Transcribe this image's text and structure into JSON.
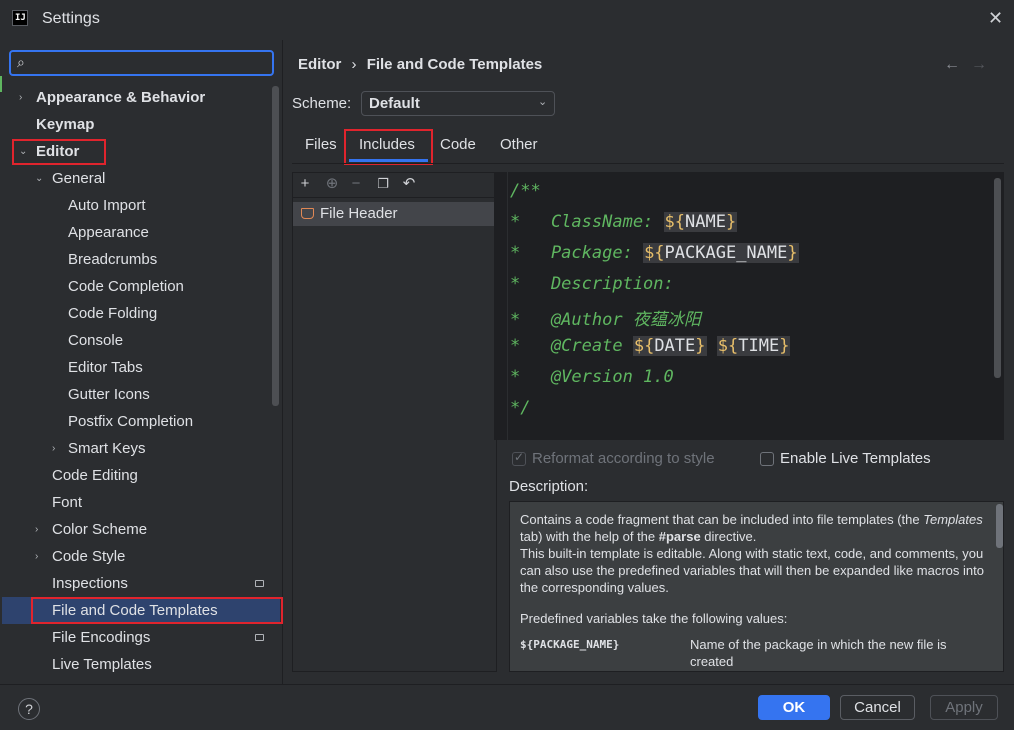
{
  "window": {
    "title": "Settings",
    "app_icon_text": "IJ"
  },
  "search": {
    "placeholder": ""
  },
  "sidebar": {
    "items": [
      {
        "label": "Appearance & Behavior"
      },
      {
        "label": "Keymap"
      },
      {
        "label": "Editor"
      },
      {
        "label": "General"
      },
      {
        "label": "Auto Import"
      },
      {
        "label": "Appearance"
      },
      {
        "label": "Breadcrumbs"
      },
      {
        "label": "Code Completion"
      },
      {
        "label": "Code Folding"
      },
      {
        "label": "Console"
      },
      {
        "label": "Editor Tabs"
      },
      {
        "label": "Gutter Icons"
      },
      {
        "label": "Postfix Completion"
      },
      {
        "label": "Smart Keys"
      },
      {
        "label": "Code Editing"
      },
      {
        "label": "Font"
      },
      {
        "label": "Color Scheme"
      },
      {
        "label": "Code Style"
      },
      {
        "label": "Inspections"
      },
      {
        "label": "File and Code Templates"
      },
      {
        "label": "File Encodings"
      },
      {
        "label": "Live Templates"
      }
    ],
    "selected": "File and Code Templates"
  },
  "header": {
    "breadcrumb_parent": "Editor",
    "breadcrumb_sep": "›",
    "breadcrumb_current": "File and Code Templates",
    "back_icon": "←",
    "forward_icon": "→"
  },
  "scheme": {
    "label": "Scheme:",
    "value": "Default"
  },
  "tabs": [
    {
      "label": "Files"
    },
    {
      "label": "Includes",
      "active": true
    },
    {
      "label": "Code"
    },
    {
      "label": "Other"
    }
  ],
  "templates_list": {
    "items": [
      {
        "label": "File Header"
      }
    ]
  },
  "editor": {
    "lines": {
      "l1": "/**",
      "l2_prefix": "*   ClassName: ",
      "l2_var": "${NAME}",
      "l3_prefix": "*   Package: ",
      "l3_var": "${PACKAGE_NAME}",
      "l4": "*   Description:",
      "l5": "*   @Author 夜蕴冰阳",
      "l6_prefix": "*   @Create ",
      "l6_var1": "${DATE}",
      "l6_var2": "${TIME}",
      "l7": "*   @Version 1.0",
      "l8": "*/"
    }
  },
  "options": {
    "reformat_label": "Reformat according to style",
    "reformat_checked": true,
    "reformat_disabled": true,
    "live_templates_label": "Enable Live Templates",
    "live_templates_checked": false
  },
  "description": {
    "label": "Description:",
    "p1_a": "Contains a code fragment that can be included into file templates (the ",
    "p1_templates": "Templates",
    "p1_b": " tab) with the help of the ",
    "p1_parse": "#parse",
    "p1_c": " directive.",
    "p2": "This built-in template is editable. Along with static text, code, and comments, you can also use the predefined variables that will then be expanded like macros into the corresponding values.",
    "p3": "Predefined variables take the following values:",
    "var_name": "${PACKAGE_NAME}",
    "var_desc": "Name of the package in which the new file is created"
  },
  "footer": {
    "help": "?",
    "ok": "OK",
    "cancel": "Cancel",
    "apply": "Apply"
  },
  "colors": {
    "accent": "#3574f0",
    "highlight_box": "#e0242d",
    "comment_green": "#5fb660",
    "selection": "#2e436e"
  }
}
